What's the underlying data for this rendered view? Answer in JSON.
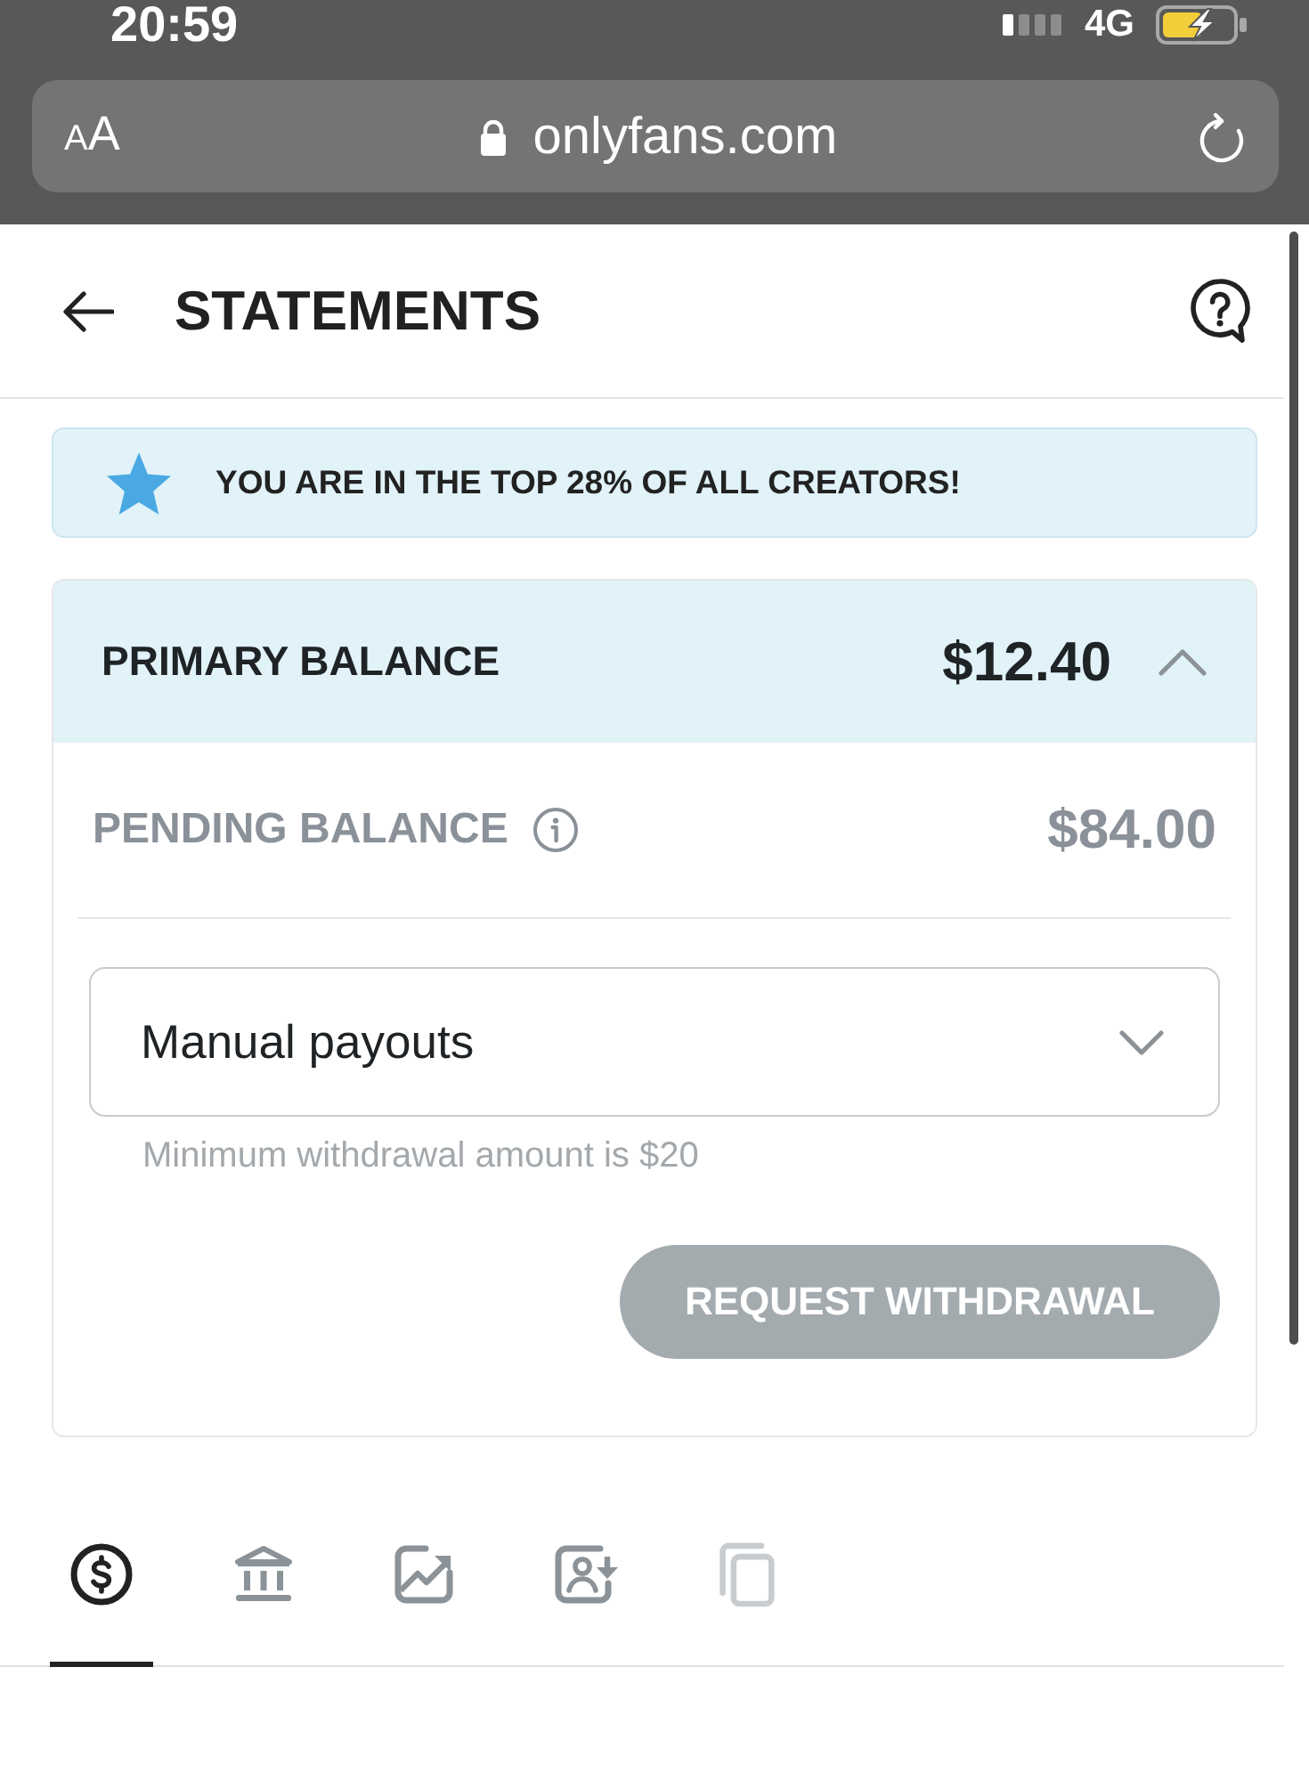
{
  "status_bar": {
    "time": "20:59",
    "network": "4G"
  },
  "browser": {
    "text_size_button": "AA",
    "url": "onlyfans.com"
  },
  "header": {
    "title": "STATEMENTS"
  },
  "banner": {
    "text": "YOU ARE IN THE TOP 28% OF ALL CREATORS!"
  },
  "balance_card": {
    "title": "PRIMARY BALANCE",
    "amount": "$12.40",
    "expanded": true,
    "pending": {
      "label": "PENDING BALANCE",
      "amount": "$84.00"
    },
    "payout_select": {
      "value": "Manual payouts"
    },
    "hint": "Minimum withdrawal amount is $20",
    "button": {
      "label": "REQUEST WITHDRAWAL",
      "disabled": true
    }
  },
  "tabs": [
    {
      "selected": true,
      "disabled": false
    },
    {
      "selected": false,
      "disabled": false
    },
    {
      "selected": false,
      "disabled": false
    },
    {
      "selected": false,
      "disabled": false
    },
    {
      "selected": false,
      "disabled": true
    }
  ]
}
